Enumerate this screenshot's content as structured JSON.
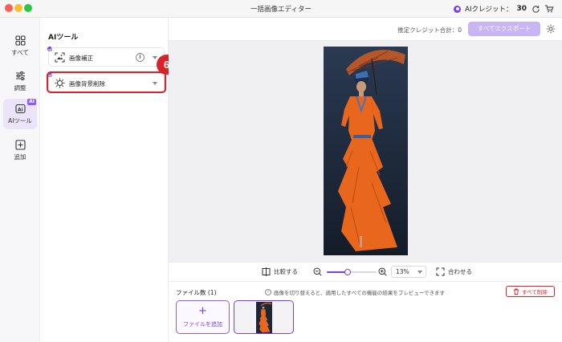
{
  "window": {
    "title": "一括画像エディター"
  },
  "credits": {
    "label": "AIクレジット：",
    "value": "30"
  },
  "nav": {
    "items": [
      {
        "label": "すべて"
      },
      {
        "label": "調整"
      },
      {
        "label": "AIツール",
        "badge": "AI"
      },
      {
        "label": "追加"
      }
    ]
  },
  "tool_panel": {
    "title": "AIツール",
    "tools": [
      {
        "label": "画像補正",
        "info": "i"
      },
      {
        "label": "画像背景削除"
      }
    ],
    "step_badge": "6"
  },
  "topbar": {
    "credit_total_label": "推定クレジット合計：",
    "credit_total_value": "0",
    "export_label": "すべてエクスポート"
  },
  "zoom": {
    "compare_label": "比較する",
    "zoom_value": "13%",
    "slider_level": 0.13,
    "fit_label": "合わせる"
  },
  "files": {
    "count_label": "ファイル数 (1)",
    "tip": "画像を切り替えると、適用したすべての機能の結果をプレビューできます",
    "delete_all_label": "すべて削除",
    "add_file_label": "ファイルを追加"
  },
  "colors": {
    "accent": "#7a3cf0",
    "highlight": "#d9232a",
    "export_disabled": "#c8b5f5"
  }
}
